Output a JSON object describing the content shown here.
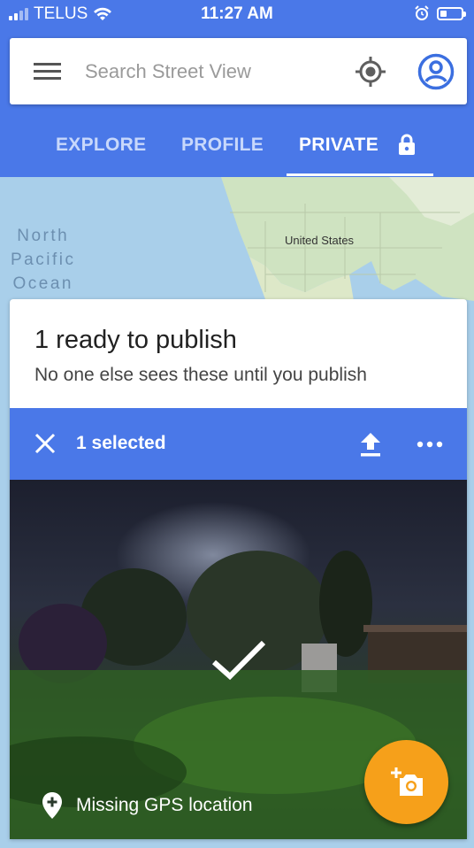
{
  "status_bar": {
    "carrier": "TELUS",
    "time": "11:27 AM"
  },
  "search": {
    "placeholder": "Search Street View"
  },
  "tabs": [
    {
      "label": "EXPLORE"
    },
    {
      "label": "PROFILE"
    },
    {
      "label": "PRIVATE"
    }
  ],
  "map": {
    "ocean_label": "North Pacific Ocean",
    "country_label": "United States"
  },
  "card": {
    "title": "1 ready to publish",
    "subtitle": "No one else sees these until you publish",
    "selection_label": "1 selected",
    "photo_caption": "Missing GPS location"
  },
  "colors": {
    "brand_blue": "#4a78e8",
    "fab_orange": "#f6a01a",
    "white": "#ffffff"
  },
  "icons": [
    "wifi-icon",
    "alarm-icon",
    "battery-icon",
    "menu-icon",
    "my-location-icon",
    "account-icon",
    "lock-icon",
    "close-icon",
    "upload-icon",
    "more-icon",
    "check-icon",
    "location-pin-icon",
    "add-photo-icon"
  ]
}
